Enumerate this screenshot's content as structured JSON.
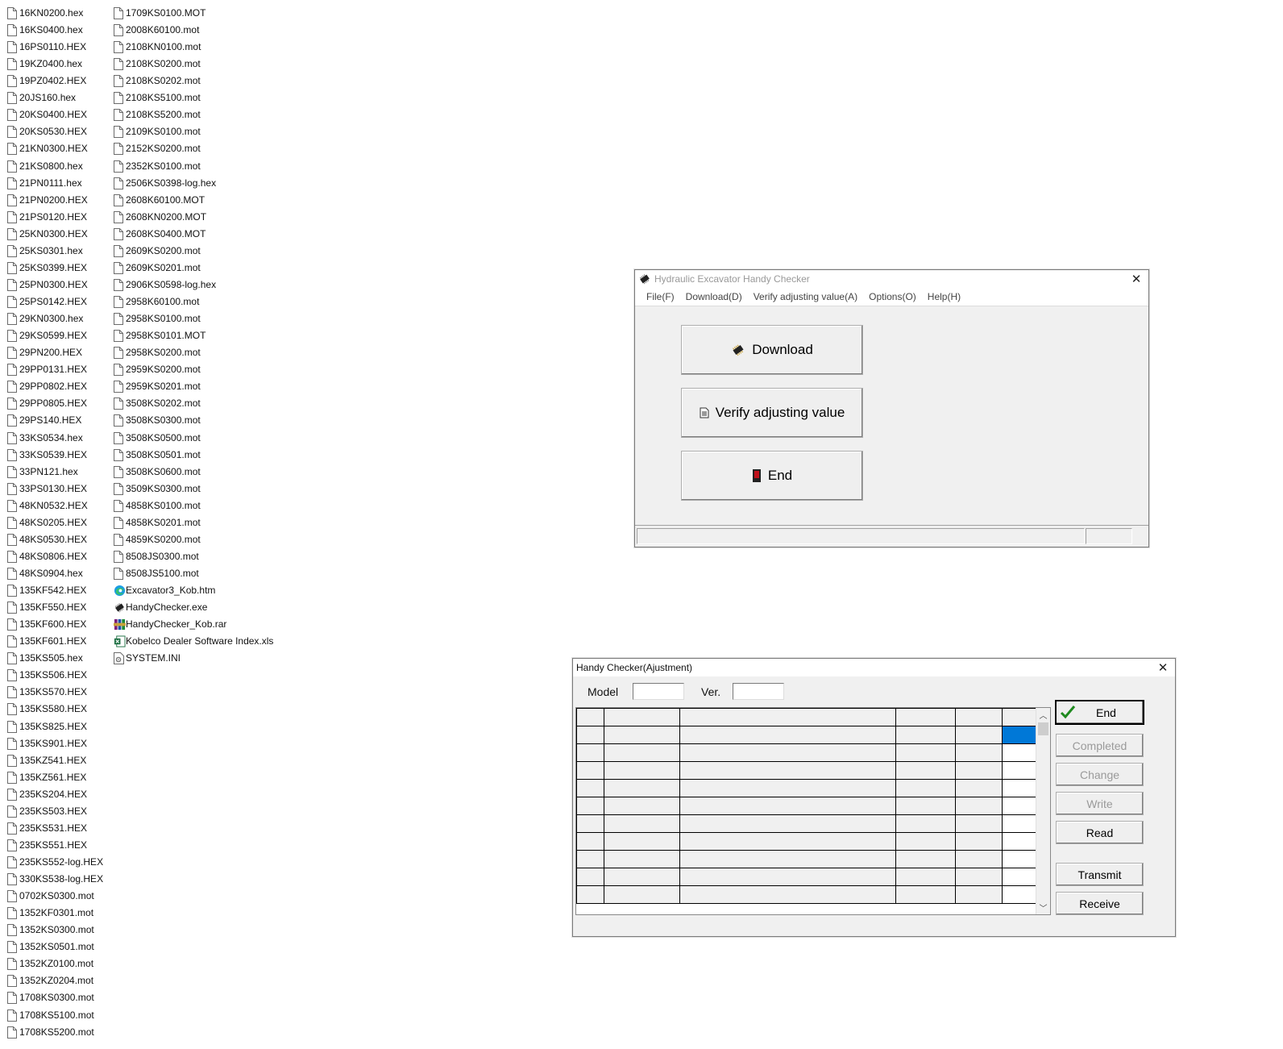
{
  "file_list": {
    "column1": [
      "16KN0200.hex",
      "16KS0400.hex",
      "16PS0110.HEX",
      "19KZ0400.hex",
      "19PZ0402.HEX",
      "20JS160.hex",
      "20KS0400.HEX",
      "20KS0530.HEX",
      "21KN0300.HEX",
      "21KS0800.hex",
      "21PN0111.hex",
      "21PN0200.HEX",
      "21PS0120.HEX",
      "25KN0300.HEX",
      "25KS0301.hex",
      "25KS0399.HEX",
      "25PN0300.HEX",
      "25PS0142.HEX",
      "29KN0300.hex",
      "29KS0599.HEX",
      "29PN200.HEX",
      "29PP0131.HEX",
      "29PP0802.HEX",
      "29PP0805.HEX",
      "29PS140.HEX",
      "33KS0534.hex",
      "33KS0539.HEX",
      "33PN121.hex",
      "33PS0130.HEX",
      "48KN0532.HEX",
      "48KS0205.HEX",
      "48KS0530.HEX",
      "48KS0806.HEX",
      "48KS0904.hex",
      "135KF542.HEX",
      "135KF550.HEX",
      "135KF600.HEX",
      "135KF601.HEX",
      "135KS505.hex",
      "135KS506.HEX",
      "135KS570.HEX",
      "135KS580.HEX",
      "135KS825.HEX",
      "135KS901.HEX",
      "135KZ541.HEX",
      "135KZ561.HEX",
      "235KS204.HEX",
      "235KS503.HEX",
      "235KS531.HEX",
      "235KS551.HEX",
      "235KS552-log.HEX",
      "330KS538-log.HEX",
      "0702KS0300.mot",
      "1352KF0301.mot",
      "1352KS0300.mot",
      "1352KS0501.mot",
      "1352KZ0100.mot",
      "1352KZ0204.mot",
      "1708KS0300.mot",
      "1708KS5100.mot",
      "1708KS5200.mot"
    ],
    "column2": [
      {
        "name": "1709KS0100.MOT",
        "icon": "file-icon"
      },
      {
        "name": "2008K60100.mot",
        "icon": "file-icon"
      },
      {
        "name": "2108KN0100.mot",
        "icon": "file-icon"
      },
      {
        "name": "2108KS0200.mot",
        "icon": "file-icon"
      },
      {
        "name": "2108KS0202.mot",
        "icon": "file-icon"
      },
      {
        "name": "2108KS5100.mot",
        "icon": "file-icon"
      },
      {
        "name": "2108KS5200.mot",
        "icon": "file-icon"
      },
      {
        "name": "2109KS0100.mot",
        "icon": "file-icon"
      },
      {
        "name": "2152KS0200.mot",
        "icon": "file-icon"
      },
      {
        "name": "2352KS0100.mot",
        "icon": "file-icon"
      },
      {
        "name": "2506KS0398-log.hex",
        "icon": "file-icon"
      },
      {
        "name": "2608K60100.MOT",
        "icon": "file-icon"
      },
      {
        "name": "2608KN0200.MOT",
        "icon": "file-icon"
      },
      {
        "name": "2608KS0400.MOT",
        "icon": "file-icon"
      },
      {
        "name": "2609KS0200.mot",
        "icon": "file-icon"
      },
      {
        "name": "2609KS0201.mot",
        "icon": "file-icon"
      },
      {
        "name": "2906KS0598-log.hex",
        "icon": "file-icon"
      },
      {
        "name": "2958K60100.mot",
        "icon": "file-icon"
      },
      {
        "name": "2958KS0100.mot",
        "icon": "file-icon"
      },
      {
        "name": "2958KS0101.MOT",
        "icon": "file-icon"
      },
      {
        "name": "2958KS0200.mot",
        "icon": "file-icon"
      },
      {
        "name": "2959KS0200.mot",
        "icon": "file-icon"
      },
      {
        "name": "2959KS0201.mot",
        "icon": "file-icon"
      },
      {
        "name": "3508KS0202.mot",
        "icon": "file-icon"
      },
      {
        "name": "3508KS0300.mot",
        "icon": "file-icon"
      },
      {
        "name": "3508KS0500.mot",
        "icon": "file-icon"
      },
      {
        "name": "3508KS0501.mot",
        "icon": "file-icon"
      },
      {
        "name": "3508KS0600.mot",
        "icon": "file-icon"
      },
      {
        "name": "3509KS0300.mot",
        "icon": "file-icon"
      },
      {
        "name": "4858KS0100.mot",
        "icon": "file-icon"
      },
      {
        "name": "4858KS0201.mot",
        "icon": "file-icon"
      },
      {
        "name": "4859KS0200.mot",
        "icon": "file-icon"
      },
      {
        "name": "8508JS0300.mot",
        "icon": "file-icon"
      },
      {
        "name": "8508JS5100.mot",
        "icon": "file-icon"
      },
      {
        "name": "Excavator3_Kob.htm",
        "icon": "edge-icon"
      },
      {
        "name": "HandyChecker.exe",
        "icon": "chip-icon"
      },
      {
        "name": "HandyChecker_Kob.rar",
        "icon": "rar-icon"
      },
      {
        "name": "Kobelco Dealer Software Index.xls",
        "icon": "excel-icon"
      },
      {
        "name": "SYSTEM.INI",
        "icon": "ini-icon"
      }
    ]
  },
  "main_window": {
    "title": "Hydraulic Excavator Handy Checker",
    "menu": [
      "File(F)",
      "Download(D)",
      "Verify adjusting value(A)",
      "Options(O)",
      "Help(H)"
    ],
    "buttons": {
      "download": "Download",
      "verify": "Verify adjusting value",
      "end": "End"
    }
  },
  "adjust_window": {
    "title": "Handy Checker(Ajustment)",
    "model_label": "Model",
    "model_value": "",
    "ver_label": "Ver.",
    "ver_value": "",
    "buttons": {
      "end": "End",
      "completed": "Completed",
      "change": "Change",
      "write": "Write",
      "read": "Read",
      "transmit": "Transmit",
      "receive": "Receive"
    }
  },
  "colors": {
    "selection": "#0078d7",
    "window_bg": "#f0f0f0"
  }
}
